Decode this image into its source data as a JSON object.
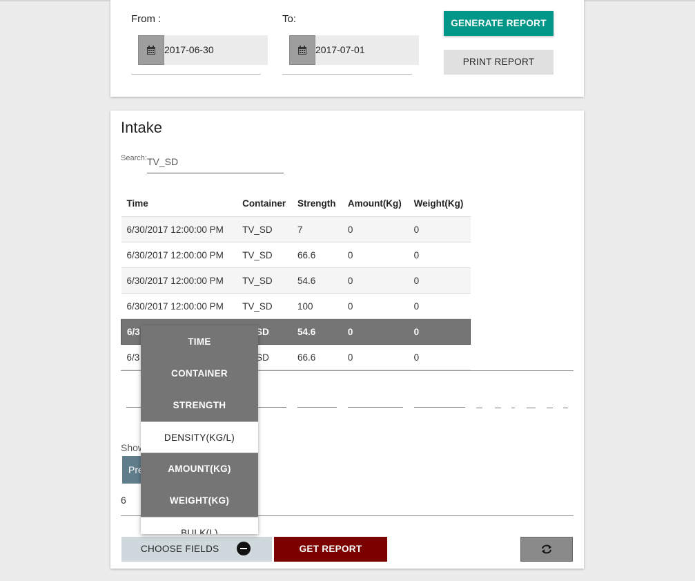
{
  "filters": {
    "from_label": "From :",
    "from_value": "2017-06-30",
    "to_label": "To:",
    "to_value": "2017-07-01",
    "generate_label": "GENERATE REPORT",
    "print_label": "PRINT REPORT"
  },
  "report": {
    "title": "Intake",
    "search_label": "Search:",
    "search_value": "TV_SD",
    "columns": [
      "Time",
      "Container",
      "Strength",
      "Amount(Kg)",
      "Weight(Kg)"
    ],
    "rows": [
      [
        "6/30/2017 12:00:00 PM",
        "TV_SD",
        "7",
        "0",
        "0"
      ],
      [
        "6/30/2017 12:00:00 PM",
        "TV_SD",
        "66.6",
        "0",
        "0"
      ],
      [
        "6/30/2017 12:00:00 PM",
        "TV_SD",
        "54.6",
        "0",
        "0"
      ],
      [
        "6/30/2017 12:00:00 PM",
        "TV_SD",
        "100",
        "0",
        "0"
      ],
      [
        "6/3",
        "SD",
        "54.6",
        "0",
        "0"
      ],
      [
        "6/3",
        "SD",
        "66.6",
        "0",
        "0"
      ]
    ],
    "show_text": "Show",
    "prev_label": "Pre",
    "page_number": "6"
  },
  "actions": {
    "choose_fields_label": "CHOOSE FIELDS",
    "get_report_label": "GET REPORT"
  },
  "field_menu": {
    "items": [
      "TIME",
      "CONTAINER",
      "STRENGTH",
      "DENSITY(KG/L)",
      "AMOUNT(KG)",
      "WEIGHT(KG)",
      "BULK(L)"
    ]
  },
  "icons": {
    "date_picker": "calendar-icon",
    "choose_fields": "minus-circle-icon",
    "refresh": "refresh-icon"
  },
  "colors": {
    "generate": "#009688",
    "get_report": "#7b0000",
    "selected_row": "#757575",
    "prev_button": "#607d8b"
  }
}
